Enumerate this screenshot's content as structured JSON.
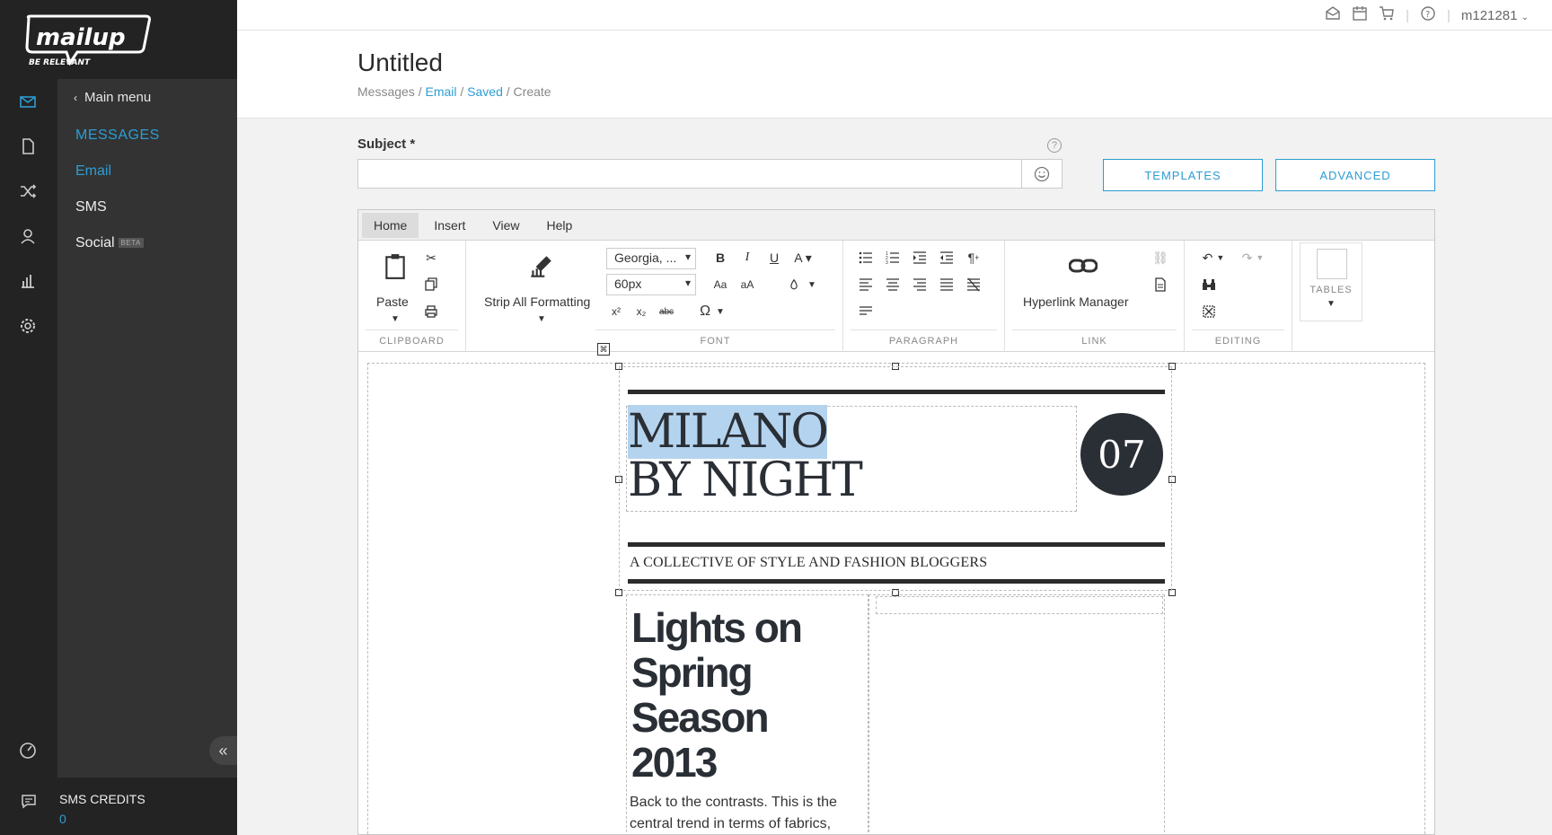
{
  "brand": {
    "name": "mailup",
    "tagline": "BE RELEVANT"
  },
  "menu": {
    "back_label": "Main menu",
    "heading": "MESSAGES",
    "items": [
      {
        "label": "Email",
        "active": true
      },
      {
        "label": "SMS",
        "active": false
      },
      {
        "label": "Social",
        "active": false,
        "badge": "BETA"
      }
    ]
  },
  "rail_icons": [
    "mail-icon",
    "document-icon",
    "shuffle-icon",
    "user-icon",
    "bar-chart-icon",
    "gear-icon",
    "speedometer-icon"
  ],
  "credits": {
    "label": "SMS CREDITS",
    "value": "0"
  },
  "topbar": {
    "user": "m121281"
  },
  "page": {
    "title": "Untitled",
    "breadcrumb": [
      {
        "label": "Messages",
        "link": false
      },
      {
        "label": "Email",
        "link": true
      },
      {
        "label": "Saved",
        "link": true
      },
      {
        "label": "Create",
        "link": false
      }
    ]
  },
  "subject": {
    "label": "Subject *",
    "value": "",
    "help": "?"
  },
  "buttons": {
    "templates": "TEMPLATES",
    "advanced": "ADVANCED"
  },
  "editor": {
    "tabs": [
      "Home",
      "Insert",
      "View",
      "Help"
    ],
    "active_tab": "Home",
    "groups": {
      "clipboard": {
        "label": "CLIPBOARD",
        "paste": "Paste"
      },
      "strip": {
        "label": "Strip All Formatting"
      },
      "font": {
        "label": "FONT",
        "family": "Georgia, ...",
        "size": "60px"
      },
      "paragraph": {
        "label": "PARAGRAPH"
      },
      "link": {
        "label": "LINK",
        "hyperlink": "Hyperlink Manager"
      },
      "editing": {
        "label": "EDITING"
      },
      "tables": {
        "label": "TABLES"
      }
    }
  },
  "email": {
    "title_line1": "MILANO",
    "title_line2": "BY NIGHT",
    "issue_number": "07",
    "tagline": "A COLLECTIVE OF STYLE AND FASHION BLOGGERS",
    "article_title": "Lights on Spring Season 2013",
    "article_body": "Back to the contrasts. This is the central trend in terms of fabrics,"
  },
  "colors": {
    "accent": "#2d9dd3",
    "sidebar": "#232323",
    "menu": "#333333",
    "selection": "#b4d3ef"
  }
}
